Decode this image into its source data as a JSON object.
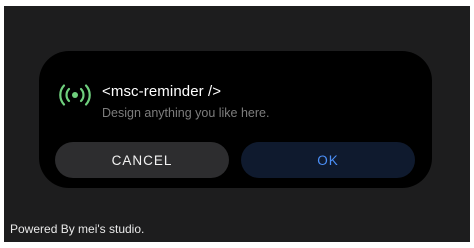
{
  "dialog": {
    "title": "<msc-reminder />",
    "subtitle": "Design anything you like here.",
    "icon": "broadcast-icon",
    "cancel_label": "CANCEL",
    "ok_label": "OK"
  },
  "footer": {
    "text": "Powered By mei's studio."
  },
  "colors": {
    "page_background": "#1d1d1e",
    "dialog_background": "#000000",
    "icon_accent": "#6fcf7d",
    "cancel_button": "#2d2d2f",
    "ok_button": "#0f1a2e",
    "ok_text": "#4b8ff7"
  }
}
